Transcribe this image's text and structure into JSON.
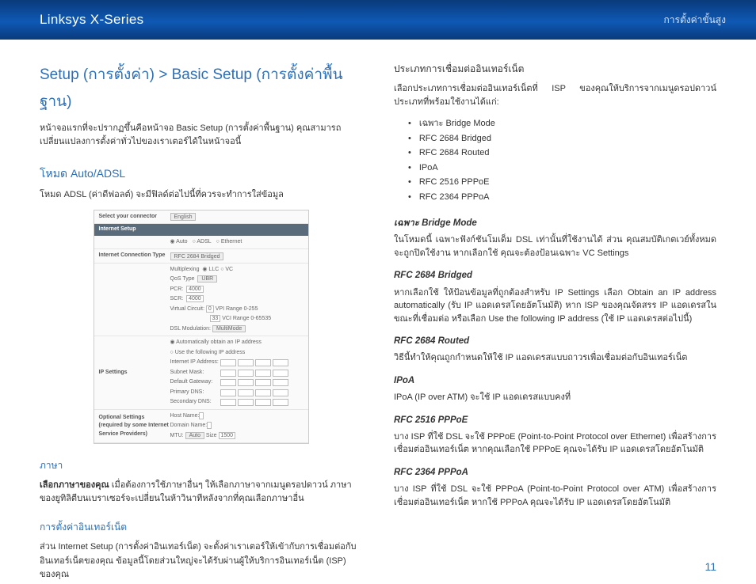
{
  "header": {
    "left": "Linksys X-Series",
    "right": "การตั้งค่าขั้นสูง"
  },
  "left": {
    "title": "Setup (การตั้งค่า) > Basic Setup (การตั้งค่าพื้นฐาน)",
    "intro": "หน้าจอแรกที่จะปรากฏขึ้นคือหน้าจอ Basic Setup (การตั้งค่าพื้นฐาน) คุณสามารถเปลี่ยนแปลงการตั้งค่าทั่วไปของเราเตอร์ได้ในหน้าจอนี้",
    "mode_h": "โหมด Auto/ADSL",
    "mode_p": "โหมด ADSL (ค่าดีฟอลต์) จะมีฟิลด์ต่อไปนี้ที่ควรจะทำการใส่ข้อมูล",
    "shot": {
      "r1l": "Select your connector",
      "r1v": "English",
      "bar": "Internet Setup",
      "r2v1": "Auto",
      "r2v2": "ADSL",
      "r2v3": "Ethernet",
      "r3l": "Internet Connection Type",
      "r3v": "RFC 2684 Bridged",
      "mpx": "Multiplexing",
      "mpxv1": "LLC",
      "mpxv2": "VC",
      "qos": "QoS Type",
      "qosv": "UBR",
      "pcr": "PCR:",
      "pcrv": "4000",
      "scr": "SCR:",
      "scrv": "4000",
      "vc": "Virtual Circuit:",
      "vcv1": "0",
      "vcv1n": "VPI Range 0-255",
      "vcv2": "33",
      "vcv2n": "VCI Range 0-65535",
      "dsl": "DSL Modulation:",
      "dslv": "MultiMode",
      "ips": "IP Settings",
      "ipa": "Automatically obtain an IP address",
      "ipb": "Use the following IP address",
      "ipr1": "Internet IP Address:",
      "ipr2": "Subnet Mask:",
      "ipr3": "Default Gateway:",
      "ipr4": "Primary DNS:",
      "ipr5": "Secondary DNS:",
      "opt": "Optional Settings (required by some Internet Service Providers)",
      "hn": "Host Name:",
      "dn": "Domain Name:",
      "mtu": "MTU:",
      "mtuv": "Auto",
      "sz": "Size",
      "szv": "1500"
    },
    "lang_h": "ภาษา",
    "lang_p_b": "เลือกภาษาของคุณ",
    "lang_p": " เมื่อต้องการใช้ภาษาอื่นๆ ให้เลือกภาษาจากเมนูดรอปดาวน์ ภาษาของยูทิลิตีบนเบราเซอร์จะเปลี่ยนในห้าวินาทีหลังจากที่คุณเลือกภาษาอื่น",
    "inet_h": "การตั้งค่าอินเทอร์เน็ต",
    "inet_p": "ส่วน Internet Setup (การตั้งค่าอินเทอร์เน็ต) จะตั้งค่าเราเตอร์ให้เข้ากับการเชื่อมต่อกับอินเทอร์เน็ตของคุณ ข้อมูลนี้โดยส่วนใหญ่จะได้รับผ่านผู้ให้บริการอินเทอร์เน็ต (ISP) ของคุณ"
  },
  "right": {
    "h": "ประเภทการเชื่อมต่ออินเทอร์เน็ต",
    "p": "เลือกประเภทการเชื่อมต่ออินเทอร์เน็ตที่ ISP ของคุณให้บริการจากเมนูดรอปดาวน์ ประเภทที่พร้อมใช้งานได้แก่:",
    "bullets": [
      "เฉพาะ Bridge Mode",
      "RFC 2684 Bridged",
      "RFC 2684 Routed",
      "IPoA",
      "RFC 2516 PPPoE",
      "RFC 2364 PPPoA"
    ],
    "s1h": "เฉพาะ Bridge Mode",
    "s1p": "ในโหมดนี้ เฉพาะฟังก์ชันโมเด็ม DSL เท่านั้นที่ใช้งานได้ ส่วน คุณสมบัติเกตเวย์ทั้งหมดจะถูกปิดใช้งาน หากเลือกใช้ คุณจะต้องป้อนเฉพาะ VC Settings",
    "s2h": "RFC 2684 Bridged",
    "s2p": "หากเลือกใช้ ให้ป้อนข้อมูลที่ถูกต้องสำหรับ IP Settings เลือก Obtain an IP address automatically (รับ IP แอดเดรสโดยอัตโนมัติ) หาก ISP ของคุณจัดสรร IP แอดเดรสในขณะที่เชื่อมต่อ หรือเลือก Use the following IP address (ใช้ IP แอดเดรสต่อไปนี้)",
    "s3h": "RFC 2684 Routed",
    "s3p": "วิธีนี้ทำให้คุณถูกกำหนดให้ใช้ IP แอดเดรสแบบถาวรเพื่อเชื่อมต่อกับอินเทอร์เน็ต",
    "s4h": "IPoA",
    "s4p": "IPoA (IP over ATM) จะใช้ IP แอดเดรสแบบคงที่",
    "s5h": "RFC 2516 PPPoE",
    "s5p": "บาง ISP ที่ใช้ DSL จะใช้ PPPoE (Point-to-Point Protocol over Ethernet) เพื่อสร้างการเชื่อมต่ออินเทอร์เน็ต หากคุณเลือกใช้ PPPoE คุณจะได้รับ IP แอดเดรสโดยอัตโนมัติ",
    "s6h": "RFC 2364 PPPoA",
    "s6p": "บาง ISP ที่ใช้ DSL จะใช้ PPPoA (Point-to-Point Protocol over ATM) เพื่อสร้างการเชื่อมต่ออินเทอร์เน็ต หากใช้ PPPoA คุณจะได้รับ IP แอดเดรสโดยอัตโนมัติ"
  },
  "pagenum": "11"
}
